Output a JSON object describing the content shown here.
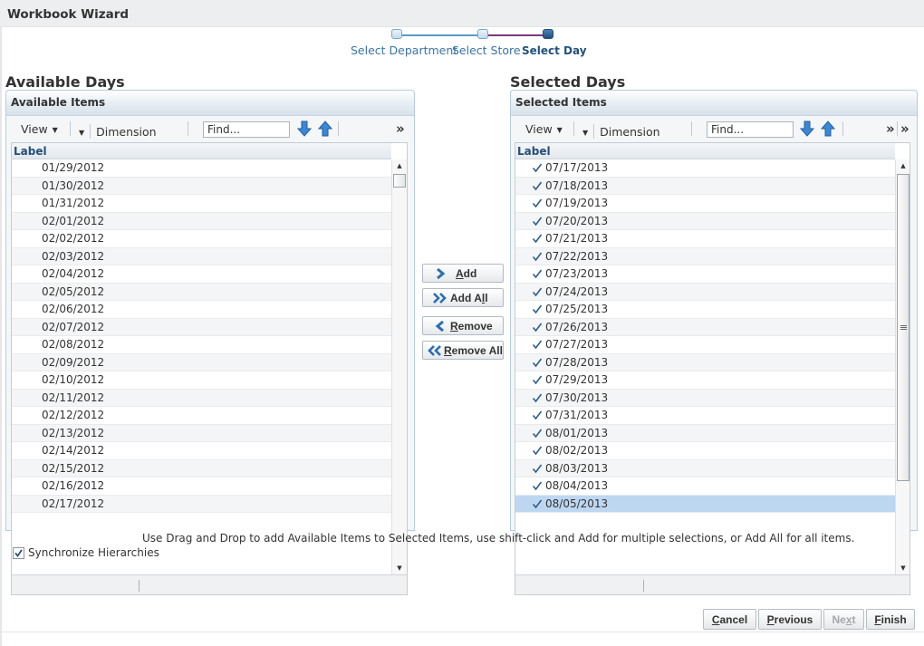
{
  "window": {
    "title": "Workbook Wizard"
  },
  "train": {
    "steps": [
      {
        "label": "Select Department",
        "state": "visited"
      },
      {
        "label": "Select Store",
        "state": "visited"
      },
      {
        "label": "Select Day",
        "state": "current"
      }
    ]
  },
  "available": {
    "section_title": "Available Days",
    "panel_title": "Available Items",
    "toolbar": {
      "view_label": "View",
      "dimension_label": "Dimension",
      "find_placeholder": "Find...",
      "overflow": "»"
    },
    "column_header": "Label",
    "items": [
      "01/29/2012",
      "01/30/2012",
      "01/31/2012",
      "02/01/2012",
      "02/02/2012",
      "02/03/2012",
      "02/04/2012",
      "02/05/2012",
      "02/06/2012",
      "02/07/2012",
      "02/08/2012",
      "02/09/2012",
      "02/10/2012",
      "02/11/2012",
      "02/12/2012",
      "02/13/2012",
      "02/14/2012",
      "02/15/2012",
      "02/16/2012",
      "02/17/2012"
    ]
  },
  "selected": {
    "section_title": "Selected Days",
    "panel_title": "Selected Items",
    "toolbar": {
      "view_label": "View",
      "dimension_label": "Dimension",
      "find_placeholder": "Find...",
      "overflow": "»",
      "overflow_extra": "»"
    },
    "column_header": "Label",
    "items": [
      "07/17/2013",
      "07/18/2013",
      "07/19/2013",
      "07/20/2013",
      "07/21/2013",
      "07/22/2013",
      "07/23/2013",
      "07/24/2013",
      "07/25/2013",
      "07/26/2013",
      "07/27/2013",
      "07/28/2013",
      "07/29/2013",
      "07/30/2013",
      "07/31/2013",
      "08/01/2013",
      "08/02/2013",
      "08/03/2013",
      "08/04/2013",
      "08/05/2013"
    ],
    "highlighted_item": "08/05/2013"
  },
  "shuttle": {
    "add": {
      "label_access": "A",
      "label_rest": "dd"
    },
    "add_all": {
      "label_pre": "Add A",
      "label_access": "l",
      "label_post": "l"
    },
    "remove": {
      "label_access": "R",
      "label_rest": "emove"
    },
    "remove_all": {
      "label_access": "R",
      "label_rest": "emove All"
    }
  },
  "hint": "Use Drag and Drop to add Available Items to Selected Items, use shift-click and Add for multiple selections, or Add All for all items.",
  "sync": {
    "label": "Synchronize Hierarchies",
    "checked": true
  },
  "buttons": {
    "cancel": {
      "access": "C",
      "rest": "ancel"
    },
    "previous": {
      "access": "P",
      "rest": "revious"
    },
    "next": {
      "pre": "Ne",
      "access": "x",
      "post": "t",
      "disabled": true
    },
    "finish": {
      "access": "F",
      "rest": "inish"
    }
  },
  "colors": {
    "accent": "#3a74a6",
    "selection": "#bed7f1",
    "header_text": "#254e78",
    "panel_border": "#b6cbe0"
  }
}
